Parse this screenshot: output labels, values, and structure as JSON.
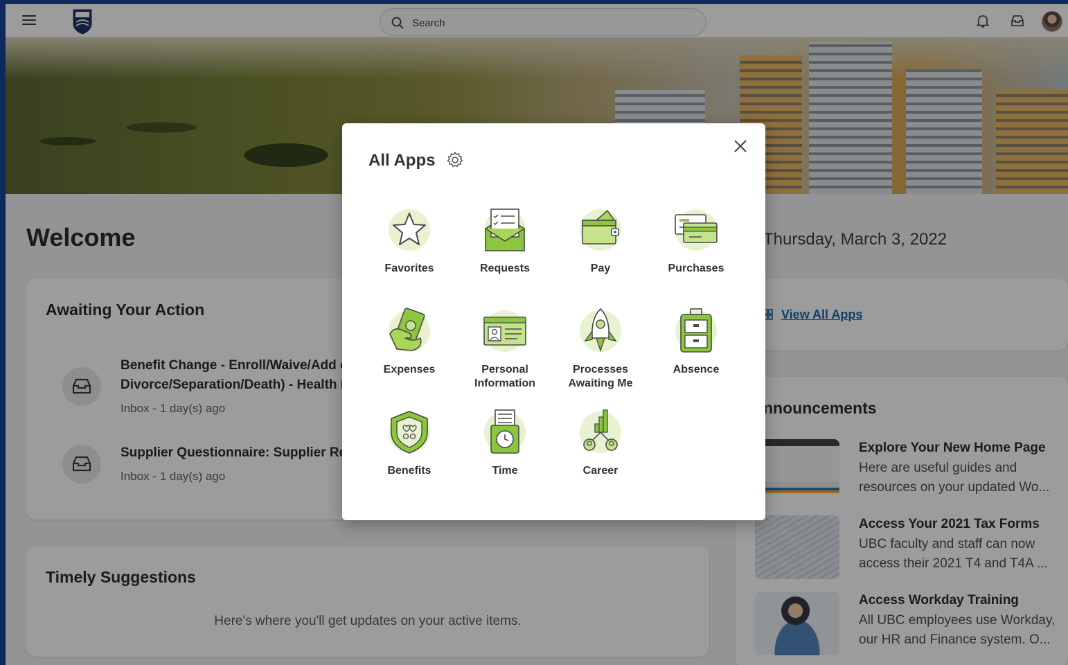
{
  "topbar": {
    "search_placeholder": "Search"
  },
  "home": {
    "welcome": "Welcome",
    "date": "Thursday, March 3, 2022",
    "view_all_apps": "View All Apps"
  },
  "awaiting": {
    "title": "Awaiting Your Action",
    "tasks": [
      {
        "line1": "Benefit Change - Enroll/Waive/Add or",
        "line2": "Divorce/Separation/Death) - Health B",
        "meta": "Inbox - 1 day(s) ago"
      },
      {
        "line1": "Supplier Questionnaire: Supplier Requ",
        "meta": "Inbox - 1 day(s) ago"
      }
    ]
  },
  "suggestions": {
    "title": "Timely Suggestions",
    "text": "Here's where you'll get updates on your active items."
  },
  "announcements": {
    "title": "nnouncements",
    "items": [
      {
        "title": "Explore Your New Home Page",
        "line1": "Here are useful guides and",
        "line2": "resources on your updated Wo..."
      },
      {
        "title": "Access Your 2021 Tax Forms",
        "line1": "UBC faculty and staff can now",
        "line2": "access their 2021 T4 and T4A ..."
      },
      {
        "title": "Access Workday Training",
        "line1": "All UBC employees use Workday,",
        "line2": "our HR and Finance system. O..."
      }
    ]
  },
  "modal": {
    "title": "All Apps",
    "apps": [
      {
        "label": "Favorites",
        "icon": "star-icon"
      },
      {
        "label": "Requests",
        "icon": "envelope-checklist-icon"
      },
      {
        "label": "Pay",
        "icon": "wallet-icon"
      },
      {
        "label": "Purchases",
        "icon": "credit-cards-icon"
      },
      {
        "label": "Expenses",
        "icon": "money-hand-icon"
      },
      {
        "label": "Personal Information",
        "icon": "id-card-icon"
      },
      {
        "label": "Processes Awaiting Me",
        "icon": "rocket-icon"
      },
      {
        "label": "Absence",
        "icon": "suitcase-icon"
      },
      {
        "label": "Benefits",
        "icon": "shield-icon"
      },
      {
        "label": "Time",
        "icon": "time-clock-icon"
      },
      {
        "label": "Career",
        "icon": "career-people-icon"
      }
    ]
  },
  "colors": {
    "accent_green": "#8cc63f",
    "icon_fill": "#e9f2d0",
    "link_blue": "#0b5fb5",
    "frame_blue": "#0e2a5c"
  }
}
